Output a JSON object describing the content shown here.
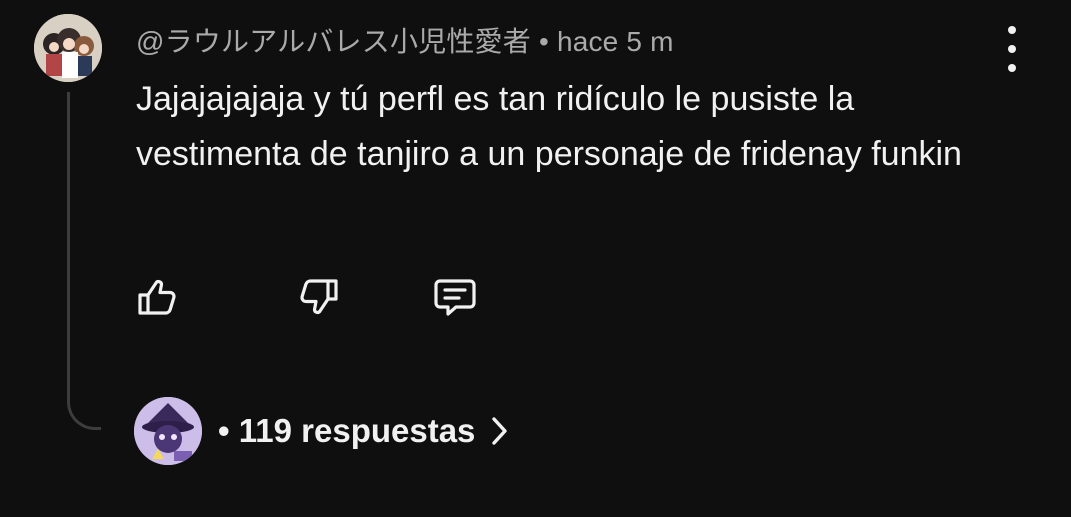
{
  "comment": {
    "author_handle": "@ラウルアルバレス小児性愛者",
    "separator": "•",
    "timestamp": "hace 5 m",
    "text": "Jajajajajaja y tú perfl es tan ridículo le pusiste la vestimenta de tanjiro a un personaje de fridenay funkin",
    "avatar_icon": "author-avatar",
    "menu_icon": "more-vert-icon"
  },
  "actions": {
    "like_icon": "thumbs-up-icon",
    "dislike_icon": "thumbs-down-icon",
    "reply_icon": "comment-icon"
  },
  "replies": {
    "prefix": "•",
    "label": "119 respuestas",
    "avatar_icon": "reply-avatar",
    "chevron_icon": "chevron-right-icon"
  },
  "colors": {
    "background": "#0f0f0f",
    "primary_text": "#f1f1f1",
    "secondary_text": "#aaaaaa",
    "thread_line": "#3d3d3d"
  }
}
